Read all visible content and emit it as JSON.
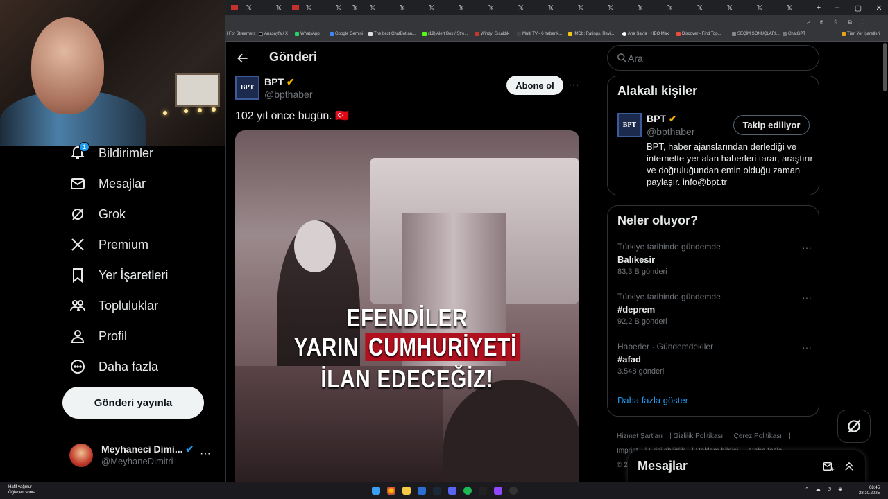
{
  "bookmarks": [
    "l For Streamers",
    "Anasayfa / X",
    "WhatsApp",
    "Google Gemini",
    "The best ChatBot an...",
    "(19) Alert Box / Stre...",
    "Windy: Sıcaklık",
    "Multi TV - 6 haber k...",
    "IMDb: Ratings, Revi...",
    "Ana Sayfa • HBO Max",
    "Discover - Find Top...",
    "SEÇİM SONUÇLARI...",
    "ChatGPT",
    "Tüm Yer İşaretleri"
  ],
  "nav": {
    "notifications": {
      "label": "Bildirimler",
      "badge": "1"
    },
    "messages": "Mesajlar",
    "grok": "Grok",
    "premium": "Premium",
    "bookmarks": "Yer İşaretleri",
    "communities": "Topluluklar",
    "profile": "Profil",
    "more": "Daha fazla",
    "post_button": "Gönderi yayınla"
  },
  "account": {
    "name": "Meyhaneci Dimi...",
    "handle": "@MeyhaneDimitri",
    "more": "···"
  },
  "main": {
    "title": "Gönderi",
    "author": {
      "avatar_text": "BPT",
      "name": "BPT",
      "handle": "@bpthaber"
    },
    "subscribe": "Abone ol",
    "more": "···",
    "text": "102 yıl önce bugün. 🇹🇷",
    "media_text": {
      "line1": "EFENDİLER",
      "line2a": "YARIN ",
      "line2b": "CUMHURİYETİ",
      "line3": "İLAN EDECEĞİZ!"
    }
  },
  "search": {
    "placeholder": "Ara"
  },
  "related": {
    "title": "Alakalı kişiler",
    "avatar_text": "BPT",
    "name": "BPT",
    "handle": "@bpthaber",
    "follow": "Takip ediliyor",
    "bio": "BPT, haber ajanslarından derlediği ve internette yer alan haberleri tarar, araştırır ve doğruluğundan emin olduğu zaman paylaşır. info@bpt.tr"
  },
  "trends": {
    "title": "Neler oluyor?",
    "items": [
      {
        "context": "Türkiye tarihinde gündemde",
        "name": "Balıkesir",
        "posts": "83,3 B gönderi"
      },
      {
        "context": "Türkiye tarihinde gündemde",
        "name": "#deprem",
        "posts": "92,2 B gönderi"
      },
      {
        "context": "Haberler · Gündemdekiler",
        "name": "#afad",
        "posts": "3.548 gönderi"
      }
    ],
    "show_more": "Daha fazla göster"
  },
  "footer": {
    "l1": [
      "Hizmet Şartları",
      "Gizlilik Politikası",
      "Çerez Politikası"
    ],
    "l2": [
      "Imprint",
      "Erişilebilirlik",
      "Reklam bilgisi",
      "Daha fazla ···"
    ],
    "l3": "© 2"
  },
  "message_drawer": {
    "title": "Mesajlar"
  },
  "taskbar": {
    "weather_line1": "Hafif yağmur",
    "weather_line2": "Öğleden sonra",
    "time": "08:45",
    "date": "28.10.2025"
  },
  "colors": {
    "accent": "#1d9bf0",
    "verified": "#f4b400",
    "background": "#000000",
    "red_banner": "#b1111f"
  }
}
